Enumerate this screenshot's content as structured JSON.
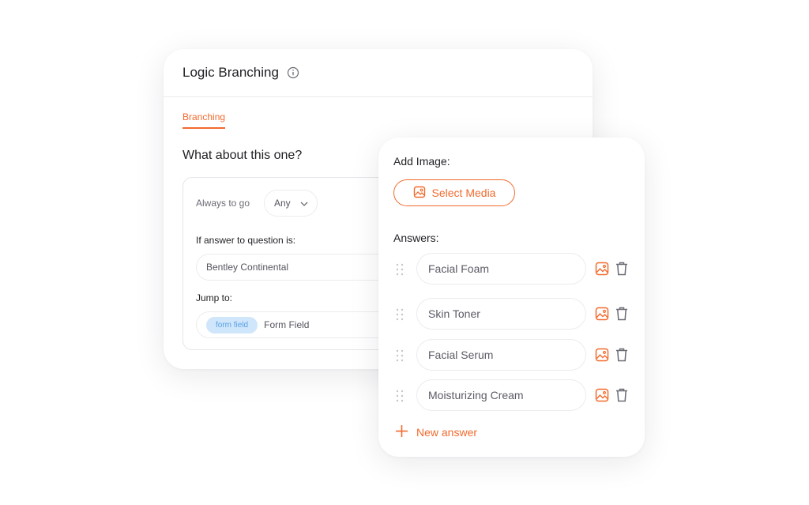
{
  "logic": {
    "title": "Logic Branching",
    "tab": "Branching",
    "question": "What about this one?",
    "always_label": "Always to go",
    "any_value": "Any",
    "if_label": "If answer to question is:",
    "if_value": "Bentley Continental",
    "jump_label": "Jump to:",
    "jump_chip": "form field",
    "jump_value": "Form Field"
  },
  "answers_panel": {
    "add_image_label": "Add Image:",
    "select_media": "Select Media",
    "answers_label": "Answers:",
    "items": [
      {
        "label": "Facial Foam"
      },
      {
        "label": "Skin Toner"
      },
      {
        "label": "Facial Serum"
      },
      {
        "label": "Moisturizing Cream"
      }
    ],
    "new_answer": "New answer"
  },
  "colors": {
    "accent": "#f26a2e",
    "chip_bg": "#cfe6fb",
    "chip_text": "#5aa0e4"
  }
}
